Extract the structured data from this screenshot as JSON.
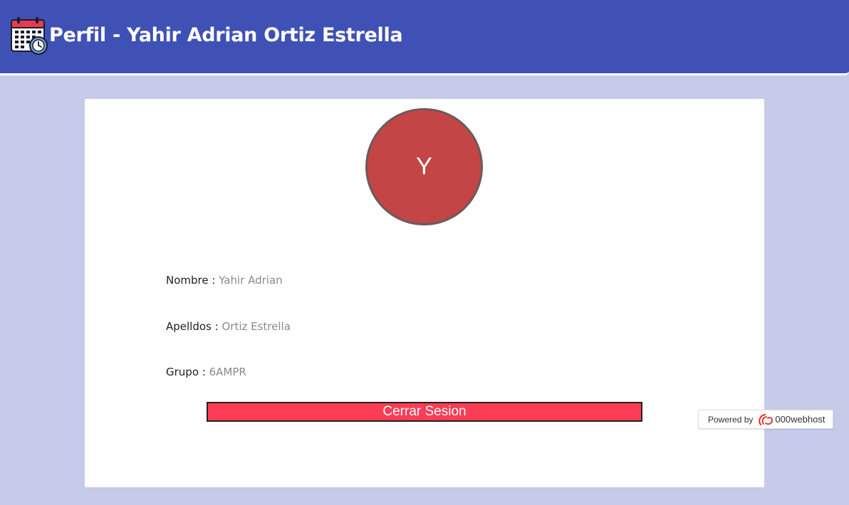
{
  "header": {
    "title": "Perfil - Yahir Adrian Ortiz Estrella",
    "icon": "calendar-clock-icon",
    "background_color": "#3f51b5"
  },
  "profile": {
    "avatar_initial": "Y",
    "avatar_color": "#c44545",
    "fields": [
      {
        "label": "Nombre :",
        "value": "Yahir Adrian"
      },
      {
        "label": "Apelldos :",
        "value": "Ortiz Estrella"
      },
      {
        "label": "Grupo :",
        "value": "6AMPR"
      }
    ],
    "logout_label": "Cerrar Sesion",
    "logout_color": "#fd3c55"
  },
  "badge": {
    "powered_by": "Powered by",
    "host_name": "000webhost",
    "logo_icon": "000webhost-logo-icon"
  }
}
